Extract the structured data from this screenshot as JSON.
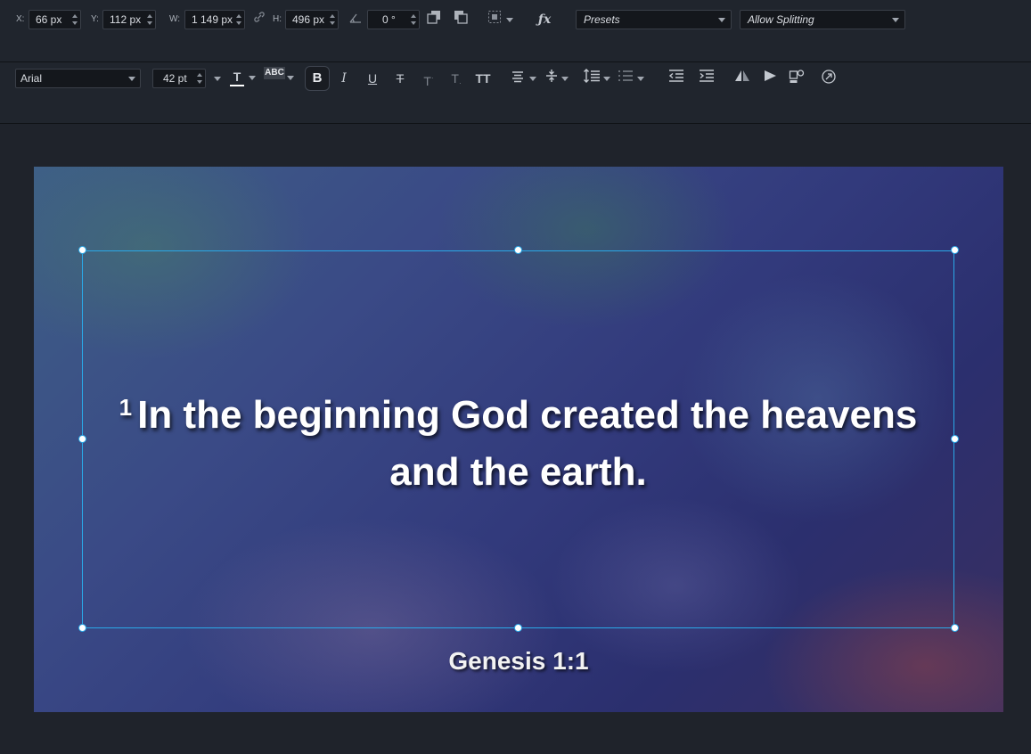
{
  "transform_bar": {
    "x_label": "X:",
    "x_value": "66 px",
    "y_label": "Y:",
    "y_value": "112 px",
    "w_label": "W:",
    "w_value": "1 149 px",
    "h_label": "H:",
    "h_value": "496 px",
    "rotation_value": "0 °",
    "fx_label": "ƒx",
    "presets_label": "Presets",
    "splitting_label": "Allow Splitting"
  },
  "text_bar": {
    "font_family": "Arial",
    "font_size": "42 pt",
    "text_color_label": "T",
    "highlight_label": "ABC",
    "bold_label": "B",
    "italic_label": "I",
    "underline_label": "U",
    "strike_label": "T",
    "superscript_label": "T",
    "subscript_label": "T",
    "allcaps_label": "TT"
  },
  "slide": {
    "verse_number": "1",
    "verse_text": "In the beginning God created the heavens and the earth.",
    "reference": "Genesis 1:1"
  },
  "colors": {
    "selection": "#2aa9e8",
    "toolbar_bg": "#20252d",
    "workspace_bg": "#1f232b"
  }
}
